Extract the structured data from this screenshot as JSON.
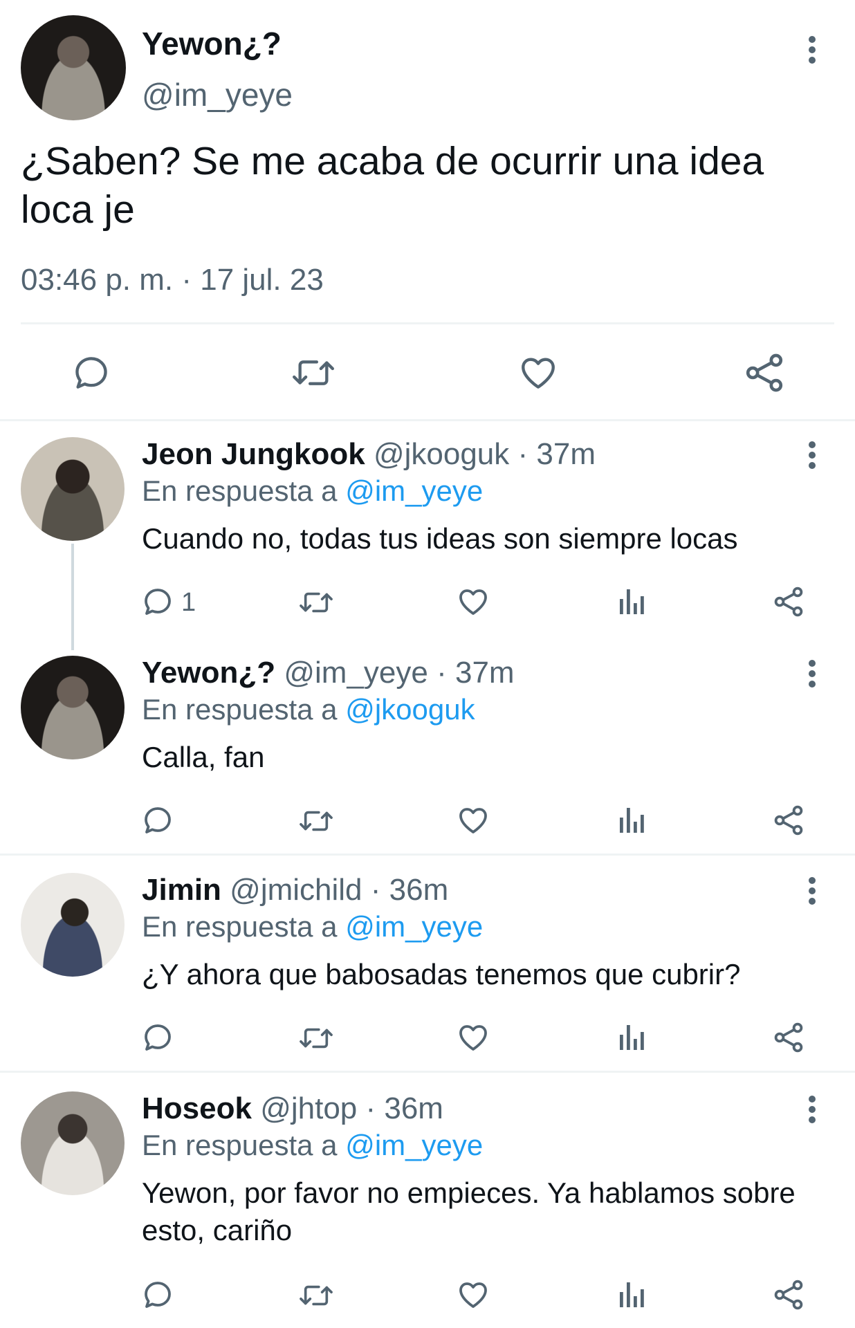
{
  "main": {
    "display_name": "Yewon¿?",
    "handle": "@im_yeye",
    "text": "¿Saben? Se me acaba de ocurrir una idea loca je",
    "timestamp": "03:46 p. m. · 17 jul. 23",
    "actions": [
      "reply-icon",
      "retweet-icon",
      "like-icon",
      "share-icon"
    ]
  },
  "replies": [
    {
      "display_name": "Jeon Jungkook",
      "handle": "@jkooguk",
      "time": " · 37m",
      "reply_prefix": "En respuesta a ",
      "reply_to": "@im_yeye",
      "text": "Cuando no, todas tus ideas son siempre locas",
      "reply_count": "1"
    },
    {
      "display_name": "Yewon¿?",
      "handle": "@im_yeye",
      "time": " · 37m",
      "reply_prefix": "En respuesta a ",
      "reply_to": "@jkooguk",
      "text": "Calla, fan"
    },
    {
      "display_name": "Jimin",
      "handle": "@jmichild",
      "time": " · 36m",
      "reply_prefix": "En respuesta a ",
      "reply_to": "@im_yeye",
      "text": "¿Y ahora que babosadas tenemos que cubrir?"
    },
    {
      "display_name": "Hoseok",
      "handle": "@jhtop",
      "time": " · 36m",
      "reply_prefix": "En respuesta a ",
      "reply_to": "@im_yeye",
      "text": "Yewon, por favor no empieces. Ya hablamos sobre esto, cariño"
    }
  ],
  "colors": {
    "text": "#0f1419",
    "muted": "#536471",
    "link": "#1d9bf0",
    "divider": "#eff3f4"
  }
}
